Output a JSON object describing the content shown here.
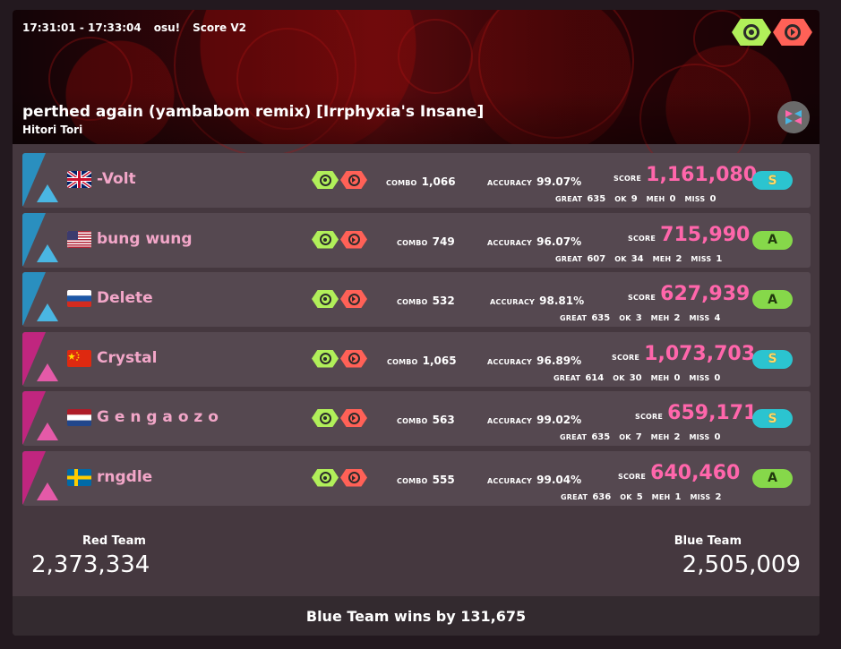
{
  "header": {
    "time_range": "17:31:01 - 17:33:04",
    "mode": "osu!",
    "scoring": "Score V2",
    "song_title": "perthed again (yambabom remix) [Irrphyxia's Insane]",
    "artist": "Hitori Tori",
    "mods": [
      "nofail-icon",
      "doubletime-icon"
    ]
  },
  "labels": {
    "combo": "COMBO",
    "accuracy": "ACCURACY",
    "score": "SCORE",
    "great": "GREAT",
    "ok": "OK",
    "meh": "MEH",
    "miss": "MISS"
  },
  "players": [
    {
      "name": "-Volt",
      "flag": "GB",
      "team": "blue",
      "combo": "1,066",
      "accuracy": "99.07%",
      "score": "1,161,080",
      "great": "635",
      "ok": "9",
      "meh": "0",
      "miss": "0",
      "rank": "S"
    },
    {
      "name": "bung wung",
      "flag": "US",
      "team": "blue",
      "combo": "749",
      "accuracy": "96.07%",
      "score": "715,990",
      "great": "607",
      "ok": "34",
      "meh": "2",
      "miss": "1",
      "rank": "A"
    },
    {
      "name": "Delete",
      "flag": "RU",
      "team": "blue",
      "combo": "532",
      "accuracy": "98.81%",
      "score": "627,939",
      "great": "635",
      "ok": "3",
      "meh": "2",
      "miss": "4",
      "rank": "A"
    },
    {
      "name": "Crystal",
      "flag": "CN",
      "team": "red",
      "combo": "1,065",
      "accuracy": "96.89%",
      "score": "1,073,703",
      "great": "614",
      "ok": "30",
      "meh": "0",
      "miss": "0",
      "rank": "S"
    },
    {
      "name": "G e n g a o z o",
      "flag": "NL",
      "team": "red",
      "combo": "563",
      "accuracy": "99.02%",
      "score": "659,171",
      "great": "635",
      "ok": "7",
      "meh": "2",
      "miss": "0",
      "rank": "S"
    },
    {
      "name": "rngdle",
      "flag": "SE",
      "team": "red",
      "combo": "555",
      "accuracy": "99.04%",
      "score": "640,460",
      "great": "636",
      "ok": "5",
      "meh": "1",
      "miss": "2",
      "rank": "A"
    }
  ],
  "teams": {
    "red": {
      "name": "Red Team",
      "score": "2,373,334"
    },
    "blue": {
      "name": "Blue Team",
      "score": "2,505,009"
    }
  },
  "result": "Blue Team wins by 131,675",
  "colors": {
    "score_pink": "#ff66ab",
    "blue_team": "#2a8fbf",
    "red_team": "#c0267f",
    "mod_green": "#b1ef5a",
    "mod_red": "#ff6157"
  }
}
